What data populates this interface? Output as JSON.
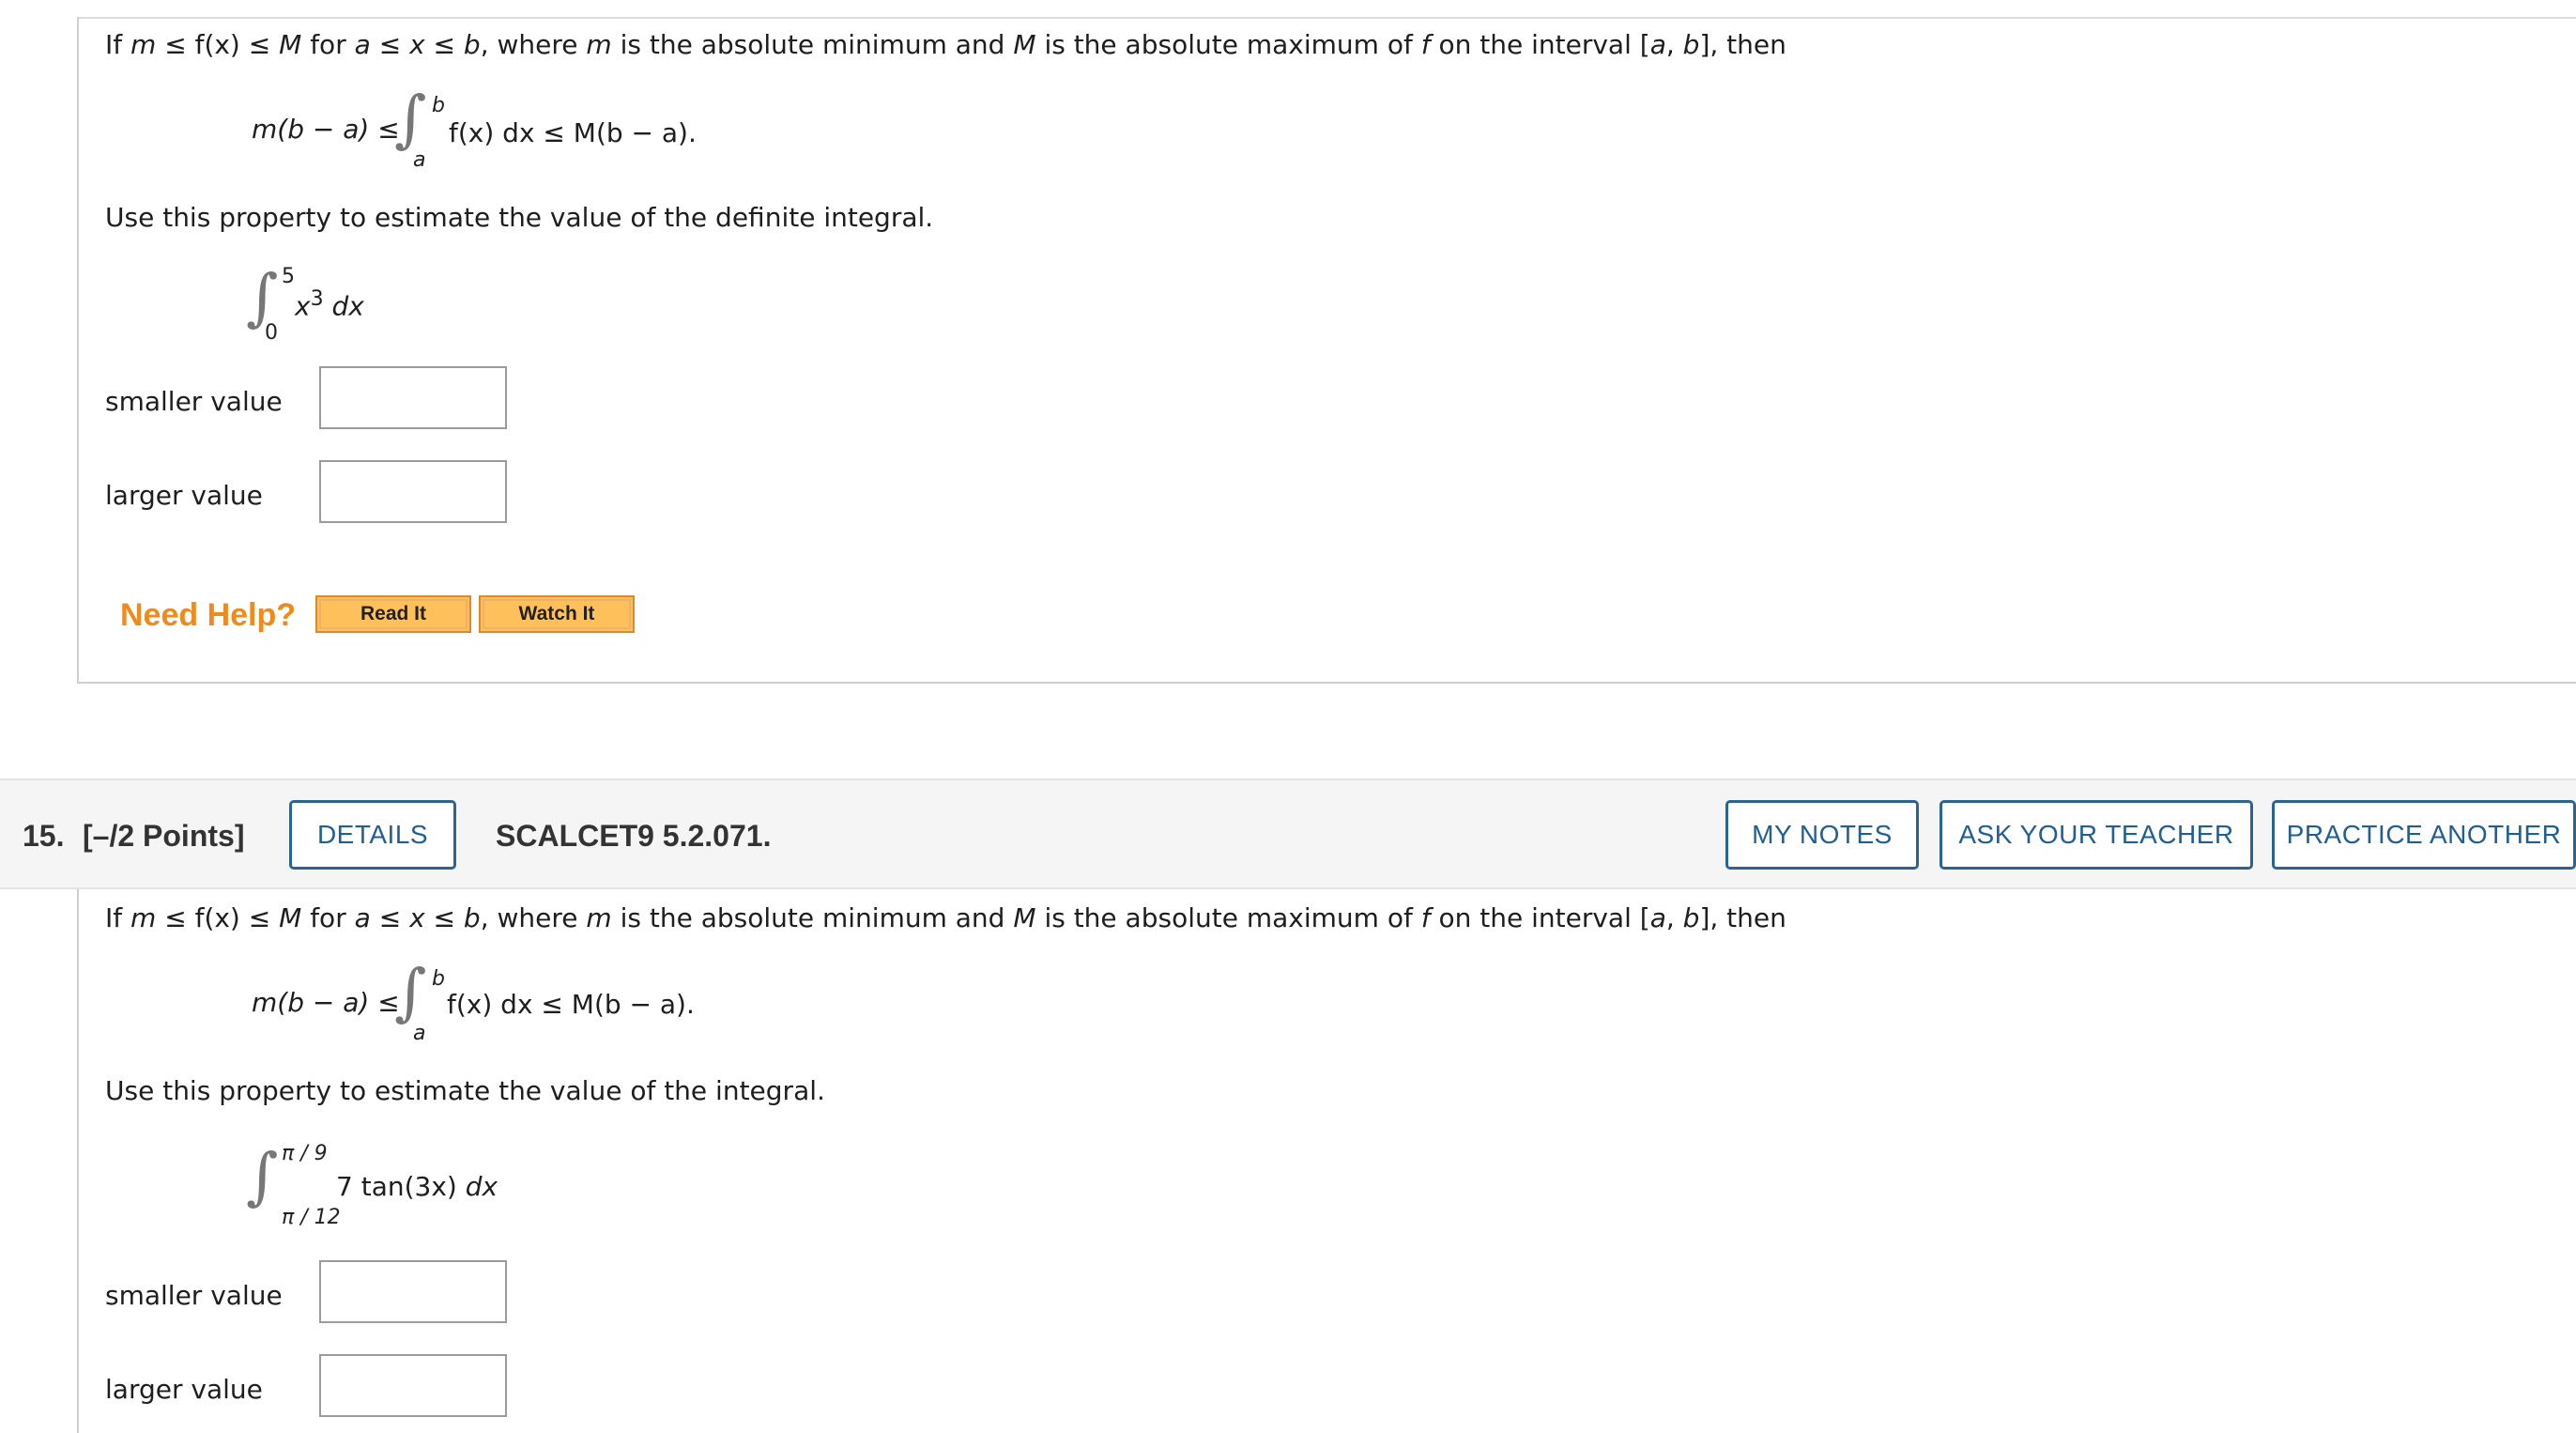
{
  "q14": {
    "intro_prefix": "If",
    "intro_m": "m",
    "intro_le1": "≤ f(x) ≤",
    "intro_M": "M",
    "intro_for": "for",
    "intro_a": "a",
    "intro_le2": "≤",
    "intro_x": "x",
    "intro_le3": "≤",
    "intro_b": "b",
    "intro_where": ", where",
    "intro_m2": "m",
    "intro_mid": "is the absolute minimum and",
    "intro_M2": "M",
    "intro_mid2": "is the absolute maximum of",
    "intro_f": "f",
    "intro_on": "on the interval [",
    "intro_a2": "a",
    "intro_comma": ",",
    "intro_b2": "b",
    "intro_end": "], then",
    "ineq_left": "m(b − a) ≤",
    "ineq_upper": "b",
    "ineq_lower": "a",
    "ineq_right": "f(x) dx ≤ M(b − a).",
    "instruction": "Use this property to estimate the value of the definite integral.",
    "integral_upper": "5",
    "integral_lower": "0",
    "integrand_base": "x",
    "integrand_exp": "3",
    "integrand_dx": "dx",
    "smaller_label": "smaller value",
    "larger_label": "larger value",
    "smaller_value": "",
    "larger_value": "",
    "need_help": "Need Help?",
    "read_it": "Read It",
    "watch_it": "Watch It"
  },
  "q15": {
    "number": "15.",
    "points": "[–/2 Points]",
    "details_button": "DETAILS",
    "code": "SCALCET9 5.2.071.",
    "my_notes_button": "MY NOTES",
    "ask_teacher_button": "ASK YOUR TEACHER",
    "practice_button": "PRACTICE ANOTHER",
    "intro_prefix": "If",
    "intro_m": "m",
    "intro_le1": "≤ f(x) ≤",
    "intro_M": "M",
    "intro_for": "for",
    "intro_a": "a",
    "intro_le2": "≤",
    "intro_x": "x",
    "intro_le3": "≤",
    "intro_b": "b",
    "intro_where": ", where",
    "intro_m2": "m",
    "intro_mid": "is the absolute minimum and",
    "intro_M2": "M",
    "intro_mid2": "is the absolute maximum of",
    "intro_f": "f",
    "intro_on": "on the interval [",
    "intro_a2": "a",
    "intro_comma": ",",
    "intro_b2": "b",
    "intro_end": "], then",
    "ineq_left": "m(b − a) ≤",
    "ineq_upper": "b",
    "ineq_lower": "a",
    "ineq_right": "f(x) dx ≤ M(b − a).",
    "instruction": "Use this property to estimate the value of the integral.",
    "integral_upper": "π / 9",
    "integral_lower": "π / 12",
    "integrand": "7 tan(3x)",
    "integrand_dx": "dx",
    "smaller_label": "smaller value",
    "larger_label": "larger value",
    "smaller_value": "",
    "larger_value": ""
  }
}
